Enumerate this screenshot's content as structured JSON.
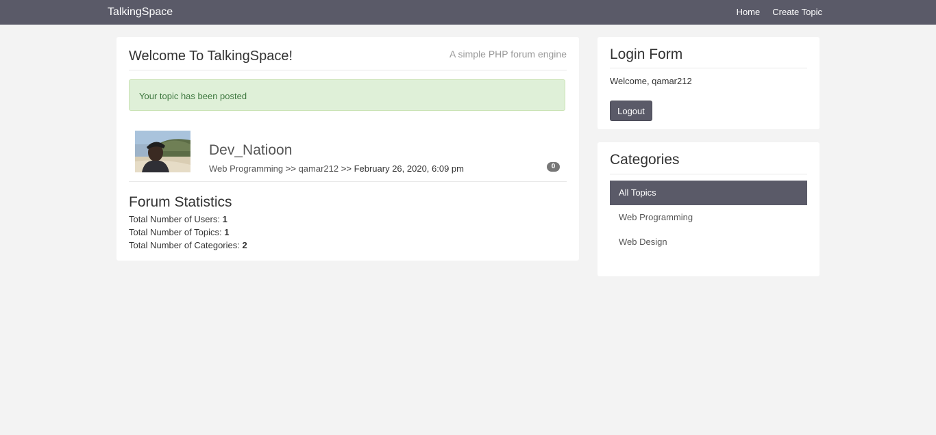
{
  "navbar": {
    "brand": "TalkingSpace",
    "links": [
      "Home",
      "Create Topic"
    ]
  },
  "main": {
    "title": "Welcome To TalkingSpace!",
    "tagline": "A simple PHP forum engine",
    "alert": "Your topic has been posted",
    "topic": {
      "title": "Dev_Natioon",
      "category": "Web Programming",
      "separator": ">>",
      "author": "qamar212",
      "date": "February 26, 2020, 6:09 pm",
      "reply_count": "0"
    },
    "stats": {
      "title": "Forum Statistics",
      "users_label": "Total Number of Users:",
      "users_value": "1",
      "topics_label": "Total Number of Topics:",
      "topics_value": "1",
      "categories_label": "Total Number of Categories:",
      "categories_value": "2"
    }
  },
  "login": {
    "title": "Login Form",
    "welcome": "Welcome, qamar212",
    "logout_label": "Logout"
  },
  "categories": {
    "title": "Categories",
    "items": [
      "All Topics",
      "Web Programming",
      "Web Design"
    ]
  },
  "colors": {
    "navbar": "#5a5a68",
    "alert_bg": "#dff0d8",
    "alert_text": "#3c763d",
    "background": "#f3f3f3"
  }
}
